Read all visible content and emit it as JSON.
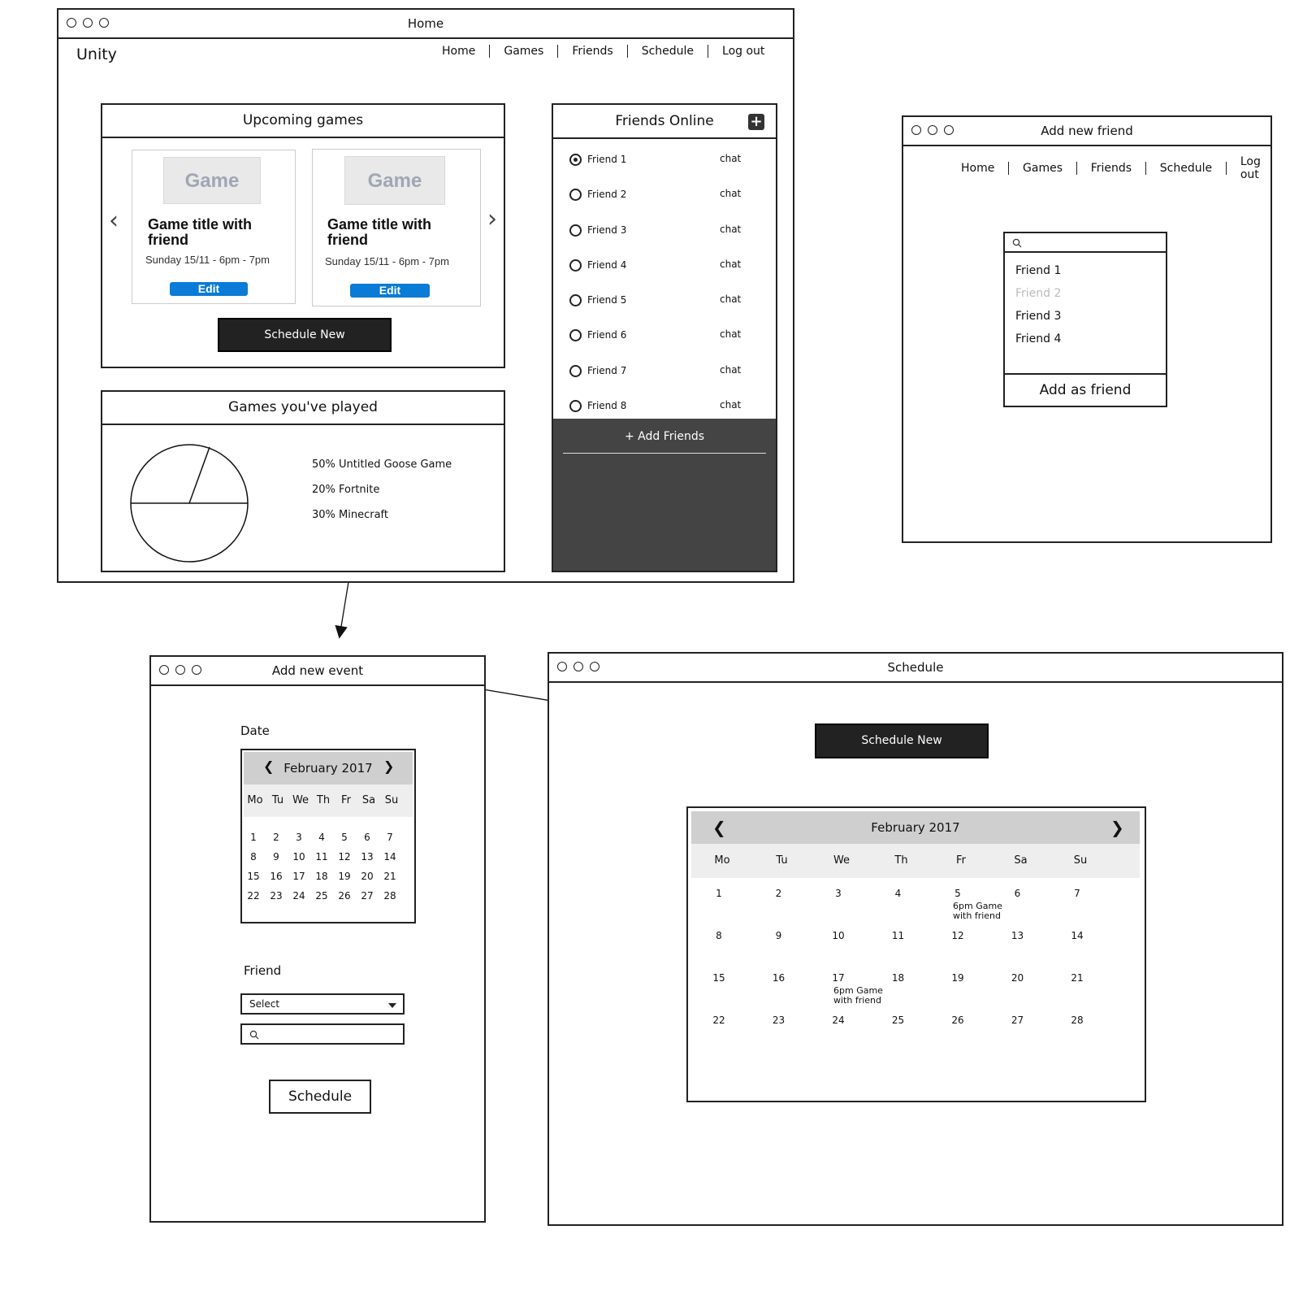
{
  "home": {
    "title": "Home",
    "logo": "Unity",
    "nav": [
      "Home",
      "Games",
      "Friends",
      "Schedule",
      "Log out"
    ],
    "upcoming": {
      "title": "Upcoming games",
      "cards": [
        {
          "image_label": "Game",
          "title": "Game title with friend",
          "date": "Sunday 15/11 - 6pm - 7pm",
          "edit": "Edit"
        },
        {
          "image_label": "Game",
          "title": "Game title with friend",
          "date": "Sunday 15/11 - 6pm - 7pm",
          "edit": "Edit"
        }
      ],
      "schedule_new": "Schedule New"
    },
    "played": {
      "title": "Games you've played",
      "legend": [
        "50% Untitled Goose Game",
        "20% Fortnite",
        "30% Minecraft"
      ]
    },
    "friends_online": {
      "title": "Friends Online",
      "items": [
        {
          "name": "Friend 1",
          "action": "chat",
          "selected": true
        },
        {
          "name": "Friend 2",
          "action": "chat",
          "selected": false
        },
        {
          "name": "Friend 3",
          "action": "chat",
          "selected": false
        },
        {
          "name": "Friend 4",
          "action": "chat",
          "selected": false
        },
        {
          "name": "Friend 5",
          "action": "chat",
          "selected": false
        },
        {
          "name": "Friend 6",
          "action": "chat",
          "selected": false
        },
        {
          "name": "Friend 7",
          "action": "chat",
          "selected": false
        },
        {
          "name": "Friend 8",
          "action": "chat",
          "selected": false
        }
      ],
      "add_friends": "+ Add Friends"
    }
  },
  "add_friend": {
    "title": "Add new friend",
    "nav": [
      "Home",
      "Games",
      "Friends",
      "Schedule",
      "Log out"
    ],
    "results": [
      {
        "name": "Friend 1",
        "disabled": false
      },
      {
        "name": "Friend 2",
        "disabled": true
      },
      {
        "name": "Friend 3",
        "disabled": false
      },
      {
        "name": "Friend 4",
        "disabled": false
      }
    ],
    "add_button": "Add as friend"
  },
  "add_event": {
    "title": "Add new event",
    "date_label": "Date",
    "calendar": {
      "month": "February 2017",
      "prev": "❮",
      "next": "❯",
      "weekdays": [
        "Mo",
        "Tu",
        "We",
        "Th",
        "Fr",
        "Sa",
        "Su"
      ],
      "days": [
        "1",
        "2",
        "3",
        "4",
        "5",
        "6",
        "7",
        "8",
        "9",
        "10",
        "11",
        "12",
        "13",
        "14",
        "15",
        "16",
        "17",
        "18",
        "19",
        "20",
        "21",
        "22",
        "23",
        "24",
        "25",
        "26",
        "27",
        "28"
      ]
    },
    "friend_label": "Friend",
    "select_value": "Select",
    "schedule_button": "Schedule"
  },
  "schedule": {
    "title": "Schedule",
    "schedule_new": "Schedule New",
    "calendar": {
      "month": "February 2017",
      "prev": "❮",
      "next": "❯",
      "weekdays": [
        "Mo",
        "Tu",
        "We",
        "Th",
        "Fr",
        "Sa",
        "Su"
      ],
      "days": [
        "1",
        "2",
        "3",
        "4",
        "5",
        "6",
        "7",
        "8",
        "9",
        "10",
        "11",
        "12",
        "13",
        "14",
        "15",
        "16",
        "17",
        "18",
        "19",
        "20",
        "21",
        "22",
        "23",
        "24",
        "25",
        "26",
        "27",
        "28"
      ],
      "events": [
        {
          "day": "5",
          "text": "6pm Game with friend"
        },
        {
          "day": "17",
          "text": "6pm Game with friend"
        }
      ]
    }
  },
  "colors": {
    "dark": "#222222",
    "panel_dark": "#444444",
    "edit_blue": "#0a7bd6",
    "cal_header": "#cfcfcf"
  }
}
